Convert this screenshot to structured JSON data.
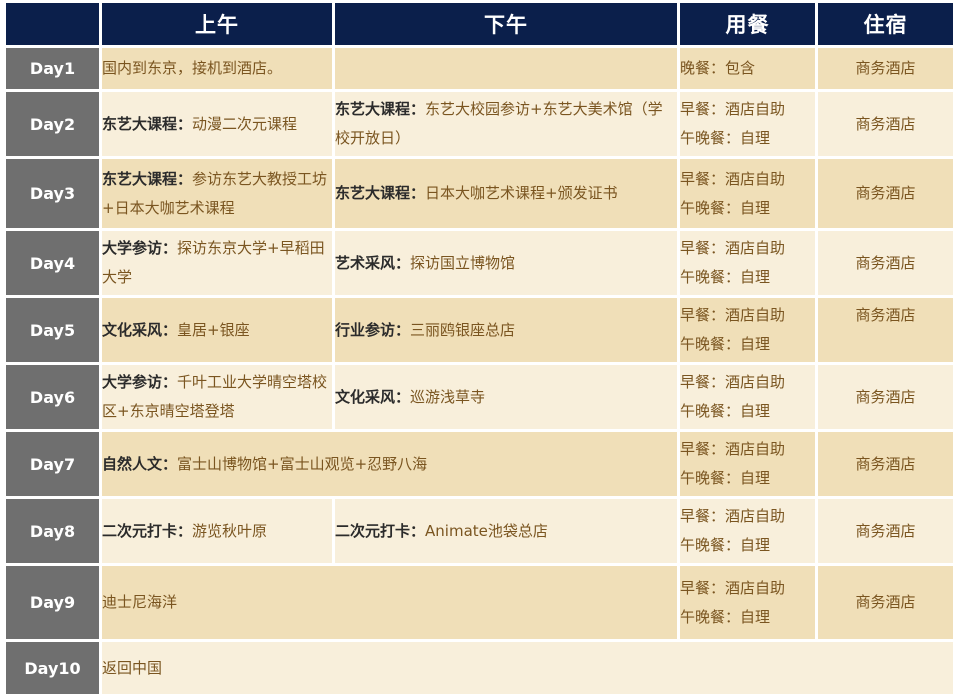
{
  "header": {
    "blank": "",
    "morning": "上午",
    "afternoon": "下午",
    "meals": "用餐",
    "hotel": "住宿"
  },
  "days": [
    {
      "day": "Day1",
      "am": {
        "tag": "",
        "text": "国内到东京，接机到酒店。"
      },
      "pm": {
        "tag": "",
        "text": ""
      },
      "meal1": "晚餐：包含",
      "meal2": "",
      "hotel": "商务酒店"
    },
    {
      "day": "Day2",
      "am": {
        "tag": "东艺大课程：",
        "text": "动漫二次元课程"
      },
      "pm": {
        "tag": "东艺大课程：",
        "text": "东艺大校园参访+东艺大美术馆（学校开放日）"
      },
      "meal1": "早餐：酒店自助",
      "meal2": "午晚餐：自理",
      "hotel": "商务酒店"
    },
    {
      "day": "Day3",
      "am": {
        "tag": "东艺大课程：",
        "text": "参访东艺大教授工坊+日本大咖艺术课程"
      },
      "pm": {
        "tag": "东艺大课程：",
        "text": "日本大咖艺术课程+颁发证书"
      },
      "meal1": "早餐：酒店自助",
      "meal2": "午晚餐：自理",
      "hotel": "商务酒店"
    },
    {
      "day": "Day4",
      "am": {
        "tag": "大学参访：",
        "text": "探访东京大学+早稻田大学"
      },
      "pm": {
        "tag": "艺术采风：",
        "text": "探访国立博物馆"
      },
      "meal1": "早餐：酒店自助",
      "meal2": "午晚餐：自理",
      "hotel": "商务酒店"
    },
    {
      "day": "Day5",
      "am": {
        "tag": "文化采风：",
        "text": "皇居+银座"
      },
      "pm": {
        "tag": "行业参访：",
        "text": "三丽鸥银座总店"
      },
      "meal1": "早餐：酒店自助",
      "meal2": "午晚餐：自理",
      "hotel": "商务酒店"
    },
    {
      "day": "Day6",
      "am": {
        "tag": "大学参访：",
        "text": "千叶工业大学晴空塔校区+东京晴空塔登塔"
      },
      "pm": {
        "tag": "文化采风：",
        "text": "巡游浅草寺"
      },
      "meal1": "早餐：酒店自助",
      "meal2": "午晚餐：自理",
      "hotel": "商务酒店"
    },
    {
      "day": "Day7",
      "am": {
        "tag": "自然人文：",
        "text": "富士山博物馆+富士山观览+忍野八海"
      },
      "meal1": "早餐：酒店自助",
      "meal2": "午晚餐：自理",
      "hotel": "商务酒店"
    },
    {
      "day": "Day8",
      "am": {
        "tag": "二次元打卡：",
        "text": "游览秋叶原"
      },
      "pm": {
        "tag": "二次元打卡：",
        "text": "Animate池袋总店"
      },
      "meal1": "早餐：酒店自助",
      "meal2": "午晚餐：自理",
      "hotel": "商务酒店"
    },
    {
      "day": "Day9",
      "am": {
        "tag": "",
        "text": "迪士尼海洋"
      },
      "meal1": "早餐：酒店自助",
      "meal2": "午晚餐：自理",
      "hotel": "商务酒店"
    },
    {
      "day": "Day10",
      "am": {
        "tag": "",
        "text": "返回中国"
      }
    }
  ]
}
